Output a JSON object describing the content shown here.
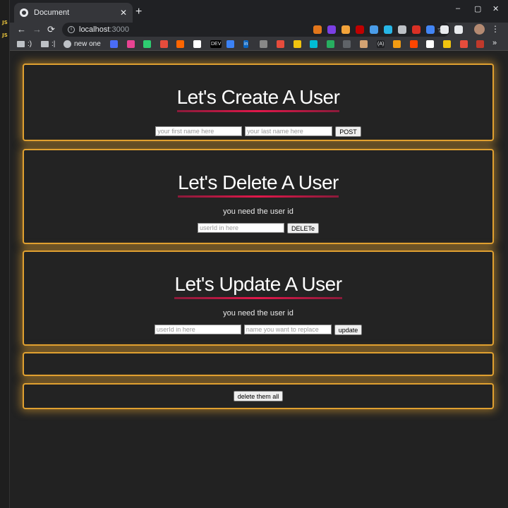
{
  "editor_strip": {
    "badges": [
      "JS",
      "JS"
    ]
  },
  "tab": {
    "title": "Document",
    "close": "✕"
  },
  "newtab": "+",
  "window_controls": {
    "minimize": "–",
    "maximize": "▢",
    "close": "✕"
  },
  "toolbar": {
    "back": "←",
    "forward": "→",
    "reload": "⟳",
    "url_host": "localhost",
    "url_port": ":3000",
    "star": "☆",
    "menu": "⋮"
  },
  "extensions": [
    {
      "name": "fox-icon",
      "color": "#e2761b"
    },
    {
      "name": "hexagon-icon",
      "color": "#7b3fe4",
      "badge": "2"
    },
    {
      "name": "feather-icon",
      "color": "#f2a33a"
    },
    {
      "name": "ublock-icon",
      "color": "#c00000"
    },
    {
      "name": "compass-icon",
      "color": "#4a9ce8"
    },
    {
      "name": "drop-icon",
      "color": "#27b6e6"
    },
    {
      "name": "glasses-icon",
      "color": "#bdc1c6"
    },
    {
      "name": "mail-icon",
      "color": "#d93025",
      "badge": "8985"
    },
    {
      "name": "shield-icon",
      "color": "#4285f4"
    },
    {
      "name": "puzzle-icon",
      "color": "#e8eaed"
    },
    {
      "name": "playlist-icon",
      "color": "#e8eaed"
    }
  ],
  "bookmarks": {
    "items": [
      {
        "label": ":)",
        "type": "folder"
      },
      {
        "label": ":|",
        "type": "folder"
      },
      {
        "label": "new one",
        "type": "wordpress"
      }
    ],
    "icons": [
      {
        "name": "c-icon",
        "color": "#4a6cf7"
      },
      {
        "name": "star-icon",
        "color": "#e84393"
      },
      {
        "name": "code-icon",
        "color": "#2ecc71"
      },
      {
        "name": "pulse-icon",
        "color": "#e74c3c"
      },
      {
        "name": "y-icon",
        "color": "#ff6600"
      },
      {
        "name": "ih-icon",
        "color": "#ffffff"
      },
      {
        "name": "dev-icon",
        "color": "#000000",
        "text": "DEV"
      },
      {
        "name": "diamond-icon",
        "color": "#3b82f6"
      },
      {
        "name": "linkedin-icon",
        "color": "#0a66c2",
        "text": "in"
      },
      {
        "name": "menu-icon",
        "color": "#888888"
      },
      {
        "name": "p-icon",
        "color": "#e74c3c"
      },
      {
        "name": "key-icon",
        "color": "#f1c40f"
      },
      {
        "name": "k-icon",
        "color": "#00bcd4"
      },
      {
        "name": "check-icon",
        "color": "#27ae60"
      },
      {
        "name": "drop2-icon",
        "color": "#5f6368"
      },
      {
        "name": "bear-icon",
        "color": "#d4a373"
      },
      {
        "name": "a-icon",
        "color": "#202124",
        "text": "(A)"
      },
      {
        "name": "box-icon",
        "color": "#f39c12"
      },
      {
        "name": "reddit-icon",
        "color": "#ff4500"
      },
      {
        "name": "github-icon",
        "color": "#ffffff"
      },
      {
        "name": "bicep-icon",
        "color": "#f1c40f"
      },
      {
        "name": "tag-icon",
        "color": "#e74c3c"
      },
      {
        "name": "square-icon",
        "color": "#c0392b"
      }
    ],
    "more": "»"
  },
  "create": {
    "heading": "Let's Create A User",
    "first_placeholder": "your first name here",
    "last_placeholder": "your last name here",
    "button": "POST"
  },
  "delete": {
    "heading": "Let's Delete A User",
    "note": "you need the user id",
    "id_placeholder": "userId in here",
    "button": "DELETe"
  },
  "update": {
    "heading": "Let's Update A User",
    "note": "you need the user id",
    "id_placeholder": "userId in here",
    "name_placeholder": "name you want to replace",
    "button": "update"
  },
  "delete_all": {
    "button": "delete them all"
  },
  "colors": {
    "accent_border": "#e0a030",
    "heading_underline": "#e0184a",
    "page_bg": "#222222"
  }
}
